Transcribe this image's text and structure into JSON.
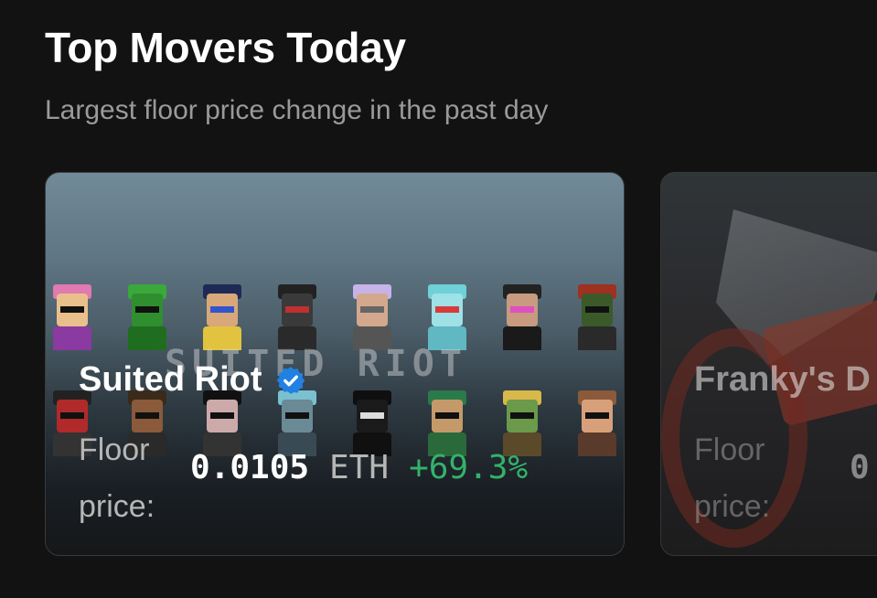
{
  "header": {
    "title": "Top Movers Today",
    "subtitle": "Largest floor price change in the past day"
  },
  "cards": [
    {
      "name": "Suited Riot",
      "verified": true,
      "image_text": "SUITED RIOT",
      "floor_label": "Floor price:",
      "price_value": "0.0105",
      "price_unit": "ETH",
      "change": "+69.3%",
      "change_color": "#33b26a"
    },
    {
      "name": "Franky's D",
      "floor_label": "Floor price:",
      "price_value": "0"
    }
  ],
  "icons": {
    "verified": "verified-badge-icon"
  },
  "colors": {
    "background": "#121212",
    "subtitle": "#9a9a9a",
    "positive": "#33b26a",
    "verified": "#2081e2"
  }
}
